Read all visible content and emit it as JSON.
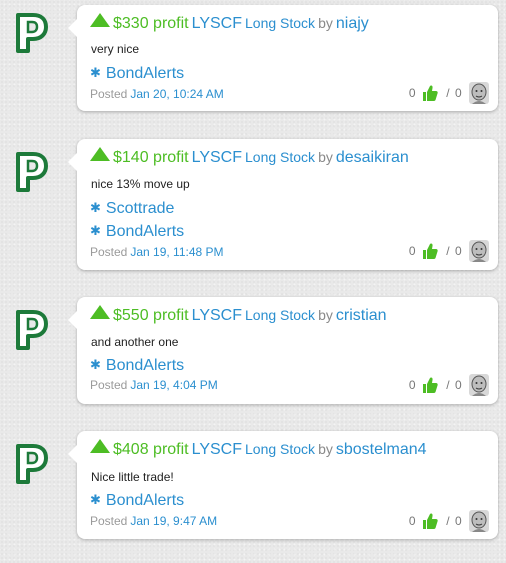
{
  "icons": {
    "logo": "p-logo-icon",
    "arrow": "up-triangle-icon",
    "tag": "gear-icon",
    "vote": "thumbs-up-icon",
    "avatar": "user-avatar-icon"
  },
  "colors": {
    "profit_green": "#4dbd24",
    "link_blue": "#2b8fcf",
    "logo_green": "#1d7a3a"
  },
  "posts": [
    {
      "profit": "$330 profit",
      "ticker": "LYSCF",
      "strategy": "Long Stock",
      "by": "by",
      "user": "niajy",
      "comment": "very nice",
      "tags": [
        "BondAlerts"
      ],
      "posted_label": "Posted",
      "posted_date": "Jan 20, 10:24 AM",
      "likes": "0",
      "sep": "/",
      "dislikes": "0"
    },
    {
      "profit": "$140 profit",
      "ticker": "LYSCF",
      "strategy": "Long Stock",
      "by": "by",
      "user": "desaikiran",
      "comment": "nice 13% move up",
      "tags": [
        "Scottrade",
        "BondAlerts"
      ],
      "posted_label": "Posted",
      "posted_date": "Jan 19, 11:48 PM",
      "likes": "0",
      "sep": "/",
      "dislikes": "0"
    },
    {
      "profit": "$550 profit",
      "ticker": "LYSCF",
      "strategy": "Long Stock",
      "by": "by",
      "user": "cristian",
      "comment": "and another one",
      "tags": [
        "BondAlerts"
      ],
      "posted_label": "Posted",
      "posted_date": "Jan 19, 4:04 PM",
      "likes": "0",
      "sep": "/",
      "dislikes": "0"
    },
    {
      "profit": "$408 profit",
      "ticker": "LYSCF",
      "strategy": "Long Stock",
      "by": "by",
      "user": "sbostelman4",
      "comment": "Nice little trade!",
      "tags": [
        "BondAlerts"
      ],
      "posted_label": "Posted",
      "posted_date": "Jan 19, 9:47 AM",
      "likes": "0",
      "sep": "/",
      "dislikes": "0"
    }
  ]
}
